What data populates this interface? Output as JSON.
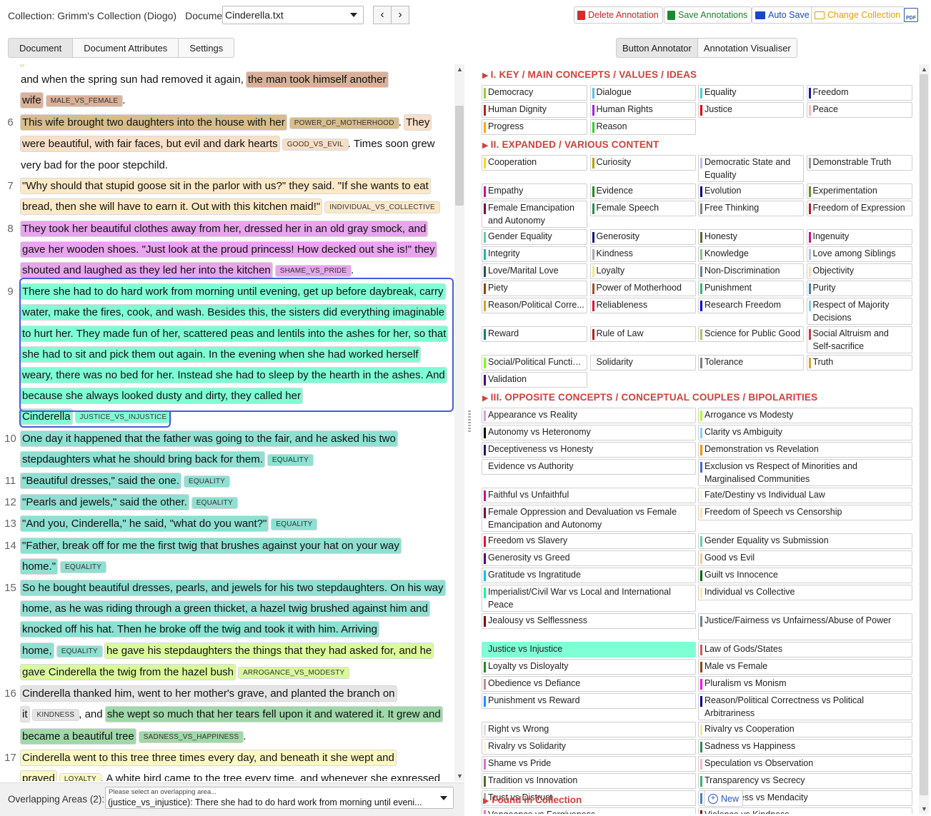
{
  "header": {
    "collection_label": "Collection: Grimm's Collection (Diogo)",
    "document_label": "Document:",
    "document_value": "Cinderella.txt",
    "prev_icon": "chevron-left-icon",
    "next_icon": "chevron-right-icon",
    "buttons": {
      "delete": "Delete Annotation",
      "save": "Save Annotations",
      "autosave": "Auto Save",
      "change": "Change Collection",
      "pdf": "PDF"
    }
  },
  "left_tabs": [
    "Document",
    "Document Attributes",
    "Settings"
  ],
  "right_tabs": [
    "Button Annotator",
    "Annotation Visualiser"
  ],
  "paragraphs": [
    {
      "num": "",
      "segments": [
        {
          "t": "",
          "bg": "#f7f79a",
          "tag": ""
        },
        {
          "t": " ",
          "bg": "",
          "tag": ""
        }
      ]
    },
    {
      "num": "",
      "segments": [
        {
          "t": "and when the spring sun had removed it again, ",
          "bg": "",
          "tag": ""
        },
        {
          "t": "the man took himself another wife",
          "bg": "#d9b19a",
          "tag": "MALE_VS_FEMALE",
          "tagbg": "#d9b19a"
        },
        {
          "t": ".",
          "bg": "",
          "tag": ""
        }
      ]
    },
    {
      "num": "6",
      "segments": [
        {
          "t": "This wife brought two daughters into the house with her",
          "bg": "#d8bd8a",
          "tag": "POWER_OF_MOTHERHOOD",
          "tagbg": "#d8bd8a"
        },
        {
          "t": ". ",
          "bg": "",
          "tag": ""
        },
        {
          "t": "They were beautiful, with fair faces, but evil and dark hearts",
          "bg": "#f7dfc8",
          "tag": "GOOD_VS_EVIL",
          "tagbg": "#f7dfc8"
        },
        {
          "t": ". Times soon grew very bad for the poor stepchild.",
          "bg": "",
          "tag": ""
        }
      ]
    },
    {
      "num": "7",
      "segments": [
        {
          "t": "\"Why should that stupid goose sit in the parlor with us?\" they said. \"If she wants to eat bread, then she will have to earn it. Out with this kitchen maid!\"",
          "bg": "#fde9c8",
          "tag": "INDIVIDUAL_VS_COLLECTIVE",
          "tagbg": "#fde9c8"
        }
      ]
    },
    {
      "num": "8",
      "segments": [
        {
          "t": "They took her beautiful clothes away from her, dressed her in an old gray smock, and gave her wooden shoes. \"Just look at the proud princess! How decked out she is!\" they shouted and laughed as they led her into the kitchen",
          "bg": "#e7a5ec",
          "tag": "SHAME_VS_PRIDE",
          "tagbg": "#e7a5ec"
        },
        {
          "t": ".",
          "bg": "",
          "tag": ""
        }
      ]
    },
    {
      "num": "9",
      "selected": true,
      "segments": [
        {
          "t": "There she had to do hard work from morning until evening, get up before daybreak, carry water, make the fires, cook, and wash. Besides this, the sisters did everything imaginable to hurt her. They made fun of her, scattered peas and lentils into the ashes for her, so that she had to sit and pick them out again. In the evening when she had worked herself weary, there was no bed for her. Instead she had to sleep by the hearth in the ashes. And because she always looked dusty and dirty, they called her Cinderella",
          "bg": "#7fffd4",
          "tag": "JUSTICE_VS_INJUSTICE",
          "tagbg": "#7fffd4"
        }
      ]
    },
    {
      "num": "10",
      "segments": [
        {
          "t": "One day it happened that the father was going to the fair, and he asked his two stepdaughters what he should bring back for them.",
          "bg": "#8ee0d2",
          "tag": "EQUALITY",
          "tagbg": "#8ee0d2"
        }
      ]
    },
    {
      "num": "11",
      "segments": [
        {
          "t": "\"Beautiful dresses,\" said the one.",
          "bg": "#8ee0d2",
          "tag": "EQUALITY",
          "tagbg": "#8ee0d2"
        }
      ]
    },
    {
      "num": "12",
      "segments": [
        {
          "t": "\"Pearls and jewels,\" said the other.",
          "bg": "#8ee0d2",
          "tag": "EQUALITY",
          "tagbg": "#8ee0d2"
        }
      ]
    },
    {
      "num": "13",
      "segments": [
        {
          "t": "\"And you, Cinderella,\" he said, \"what do you want?\"",
          "bg": "#8ee0d2",
          "tag": "EQUALITY",
          "tagbg": "#8ee0d2"
        }
      ]
    },
    {
      "num": "14",
      "segments": [
        {
          "t": "\"Father, break off for me the first twig that brushes against your hat on your way home.\"",
          "bg": "#8ee0d2",
          "tag": "EQUALITY",
          "tagbg": "#8ee0d2"
        }
      ]
    },
    {
      "num": "15",
      "segments": [
        {
          "t": "So he bought beautiful dresses, pearls, and jewels for his two stepdaughters. On his way home, as he was riding through a green thicket, a hazel twig brushed against him and knocked off his hat. Then he broke off the twig and took it with him. Arriving home,",
          "bg": "#8ee0d2",
          "tag": "EQUALITY",
          "tagbg": "#8ee0d2"
        },
        {
          "t": " ",
          "bg": "",
          "tag": ""
        },
        {
          "t": "he gave his stepdaughters the things that they had asked for, and he gave Cinderella the twig from the hazel bush",
          "bg": "#dafa9a",
          "tag": "ARROGANCE_VS_MODESTY",
          "tagbg": "#dafa9a"
        }
      ]
    },
    {
      "num": "16",
      "segments": [
        {
          "t": "Cinderella thanked him, went to her mother's grave, and planted the branch on it",
          "bg": "#e4e4e4",
          "tag": "KINDNESS",
          "tagbg": "#e4e4e4"
        },
        {
          "t": ", and ",
          "bg": "",
          "tag": ""
        },
        {
          "t": "she wept so much that her tears fell upon it and watered it. It grew and became a beautiful tree",
          "bg": "#9fd8a9",
          "tag": "SADNESS_VS_HAPPINESS",
          "tagbg": "#9fd8a9"
        },
        {
          "t": ".",
          "bg": "",
          "tag": ""
        }
      ]
    },
    {
      "num": "17",
      "segments": [
        {
          "t": "Cinderella went to this tree three times every day, and beneath it she wept and prayed",
          "bg": "#fcf8c2",
          "tag": "LOYALTY",
          "tagbg": "#fcf8c2"
        },
        {
          "t": ". A white bird came to the tree every time, and whenever she expressed a",
          "bg": "",
          "tag": ""
        }
      ]
    }
  ],
  "overlap": {
    "label": "Overlapping Areas (2):",
    "placeholder": "Please select an overlapping area...",
    "value": "(justice_vs_injustice): There she had to do hard work from morning until eveni..."
  },
  "sections": [
    {
      "title": "I. KEY / MAIN CONCEPTS / VALUES / IDEAS",
      "cols": 4,
      "buttons": [
        {
          "label": "Democracy",
          "color": "#9acd32"
        },
        {
          "label": "Dialogue",
          "color": "#5bc0de"
        },
        {
          "label": "Equality",
          "color": "#48d1cc"
        },
        {
          "label": "Freedom",
          "color": "#1a1aa8"
        },
        {
          "label": "Human Dignity",
          "color": "#b22222"
        },
        {
          "label": "Human Rights",
          "color": "#a020f0"
        },
        {
          "label": "Justice",
          "color": "#e00000"
        },
        {
          "label": "Peace",
          "color": "#ffb6c1"
        },
        {
          "label": "Progress",
          "color": "#ffa500"
        },
        {
          "label": "Reason",
          "color": "#32cd32"
        }
      ]
    },
    {
      "title": "II. EXPANDED / VARIOUS CONTENT",
      "cols": 4,
      "buttons": [
        {
          "label": "Cooperation",
          "color": "#ffd700"
        },
        {
          "label": "Curiosity",
          "color": "#b8a000"
        },
        {
          "label": "Democratic State and Equality",
          "color": "#c6b8e8",
          "tall": true
        },
        {
          "label": "Demonstrable Truth",
          "color": "#999999"
        },
        {
          "label": "Empathy",
          "color": "#c71585"
        },
        {
          "label": "Evidence",
          "color": "#228b22"
        },
        {
          "label": "Evolution",
          "color": "#000080"
        },
        {
          "label": "Experimentation",
          "color": "#6b8e23"
        },
        {
          "label": "Female Emancipation and Autonomy",
          "color": "#800040",
          "tall": true
        },
        {
          "label": "Female Speech",
          "color": "#2e8b57"
        },
        {
          "label": "Free Thinking",
          "color": "#808080"
        },
        {
          "label": "Freedom of Expression",
          "color": "#b22222"
        },
        {
          "label": "Gender Equality",
          "color": "#66cdaa"
        },
        {
          "label": "Generosity",
          "color": "#191970"
        },
        {
          "label": "Honesty",
          "color": "#556b2f"
        },
        {
          "label": "Ingenuity",
          "color": "#c71585"
        },
        {
          "label": "Integrity",
          "color": "#20b2aa"
        },
        {
          "label": "Kindness",
          "color": "#aaaaaa"
        },
        {
          "label": "Knowledge",
          "color": "#8fbc8f"
        },
        {
          "label": "Love among Siblings",
          "color": "#b0c4de"
        },
        {
          "label": "Love/Marital Love",
          "color": "#2f4f4f"
        },
        {
          "label": "Loyalty",
          "color": "#f0e68c"
        },
        {
          "label": "Non-Discrimination",
          "color": "#708090"
        },
        {
          "label": "Objectivity",
          "color": "#ffdab9"
        },
        {
          "label": "Piety",
          "color": "#8b4513"
        },
        {
          "label": "Power of Motherhood",
          "color": "#a0522d"
        },
        {
          "label": "Punishment",
          "color": "#3cb371"
        },
        {
          "label": "Purity",
          "color": "#4682b4"
        },
        {
          "label": "Reason/Political Corre...",
          "color": "#daa520"
        },
        {
          "label": "Reliableness",
          "color": "#dc143c"
        },
        {
          "label": "Research Freedom",
          "color": "#0000cd"
        },
        {
          "label": "Respect of Majority Decisions",
          "color": "#87ceeb",
          "tall": true
        },
        {
          "label": "Reward",
          "color": "#008080"
        },
        {
          "label": "Rule of Law",
          "color": "#b22222"
        },
        {
          "label": "Science for Public Good",
          "color": "#bdb76b"
        },
        {
          "label": "Social Altruism and Self-sacrifice",
          "color": "#c04040",
          "tall": true
        },
        {
          "label": "Social/Political Functio...",
          "color": "#7cfc00"
        },
        {
          "label": "Solidarity",
          "color": "#ffffff"
        },
        {
          "label": "Tolerance",
          "color": "#808080"
        },
        {
          "label": "Truth",
          "color": "#daa520"
        },
        {
          "label": "Validation",
          "color": "#4b0082"
        }
      ]
    },
    {
      "title": "III. OPPOSITE CONCEPTS / CONCEPTUAL COUPLES / BIPOLARITIES",
      "cols": 2,
      "buttons": [
        {
          "label": "Appearance vs Reality",
          "color": "#d8a0d8"
        },
        {
          "label": "Arrogance vs Modesty",
          "color": "#adff2f"
        },
        {
          "label": "Autonomy vs Heteronomy",
          "color": "#000000"
        },
        {
          "label": "Clarity vs Ambiguity",
          "color": "#87cefa"
        },
        {
          "label": "Deceptiveness vs Honesty",
          "color": "#191970"
        },
        {
          "label": "Demonstration vs Revelation",
          "color": "#ff8c00"
        },
        {
          "label": "Evidence vs Authority",
          "color": "#ffffff"
        },
        {
          "label": "Exclusion vs Respect of Minorities and Marginalised Communities",
          "color": "#4169e1",
          "tall": true
        },
        {
          "label": "Faithful vs Unfaithful",
          "color": "#c71585"
        },
        {
          "label": "Fate/Destiny vs Individual Law",
          "color": "#f5f5dc"
        },
        {
          "label": "Female Oppression and Devaluation vs Female Emancipation and Autonomy",
          "color": "#800040",
          "tall": true
        },
        {
          "label": "Freedom of Speech vs Censorship",
          "color": "#ffdead"
        },
        {
          "label": "Freedom vs Slavery",
          "color": "#dc143c"
        },
        {
          "label": "Gender Equality vs Submission",
          "color": "#66cdaa"
        },
        {
          "label": "Generosity vs Greed",
          "color": "#4b0082"
        },
        {
          "label": "Good vs Evil",
          "color": "#f4c8a0"
        },
        {
          "label": "Gratitude vs Ingratitude",
          "color": "#00bfff"
        },
        {
          "label": "Guilt vs Innocence",
          "color": "#006400"
        },
        {
          "label": "Imperialist/Civil War vs Local and International Peace",
          "color": "#00fa9a",
          "tall": true
        },
        {
          "label": "Individual vs Collective",
          "color": "#ffe4b5"
        },
        {
          "label": "Jealousy vs Selflessness",
          "color": "#800000"
        },
        {
          "label": "Justice/Fairness vs Unfairness/Abuse of Power",
          "color": "#708090",
          "tall": true
        },
        {
          "label": "Justice vs Injustice",
          "color": "#7fffd4",
          "sel": true
        },
        {
          "label": "Law of Gods/States",
          "color": "#cd5c5c"
        },
        {
          "label": "Loyalty vs Disloyalty",
          "color": "#228b22"
        },
        {
          "label": "Male vs Female",
          "color": "#8b4513"
        },
        {
          "label": "Obedience vs Defiance",
          "color": "#bc8f8f"
        },
        {
          "label": "Pluralism vs Monism",
          "color": "#ff00ff"
        },
        {
          "label": "Punishment vs Reward",
          "color": "#1e90ff"
        },
        {
          "label": "Reason/Political Correctness vs Political Arbitrariness",
          "color": "#000080",
          "tall": true
        },
        {
          "label": "Right vs Wrong",
          "color": "#dcdcdc"
        },
        {
          "label": "Rivalry vs Cooperation",
          "color": "#eee8aa"
        },
        {
          "label": "Rivalry vs Solidarity",
          "color": "#fff0dc"
        },
        {
          "label": "Sadness vs Happiness",
          "color": "#2e8b57"
        },
        {
          "label": "Shame vs Pride",
          "color": "#da70d6"
        },
        {
          "label": "Speculation vs Observation",
          "color": "#ffb6c1"
        },
        {
          "label": "Tradition vs Innovation",
          "color": "#556b2f"
        },
        {
          "label": "Transparency vs Secrecy",
          "color": "#3cb371"
        },
        {
          "label": "Trust vs Distrust",
          "color": "#a9a9a9"
        },
        {
          "label": "Truthfulness vs Mendacity",
          "color": "#4682b4"
        },
        {
          "label": "Vengeance vs Forgiveness",
          "color": "#ff69b4"
        },
        {
          "label": "Violence vs Kindness",
          "color": "#8b0000"
        }
      ]
    }
  ],
  "new_button": "New",
  "found_label": "Found in Collection"
}
